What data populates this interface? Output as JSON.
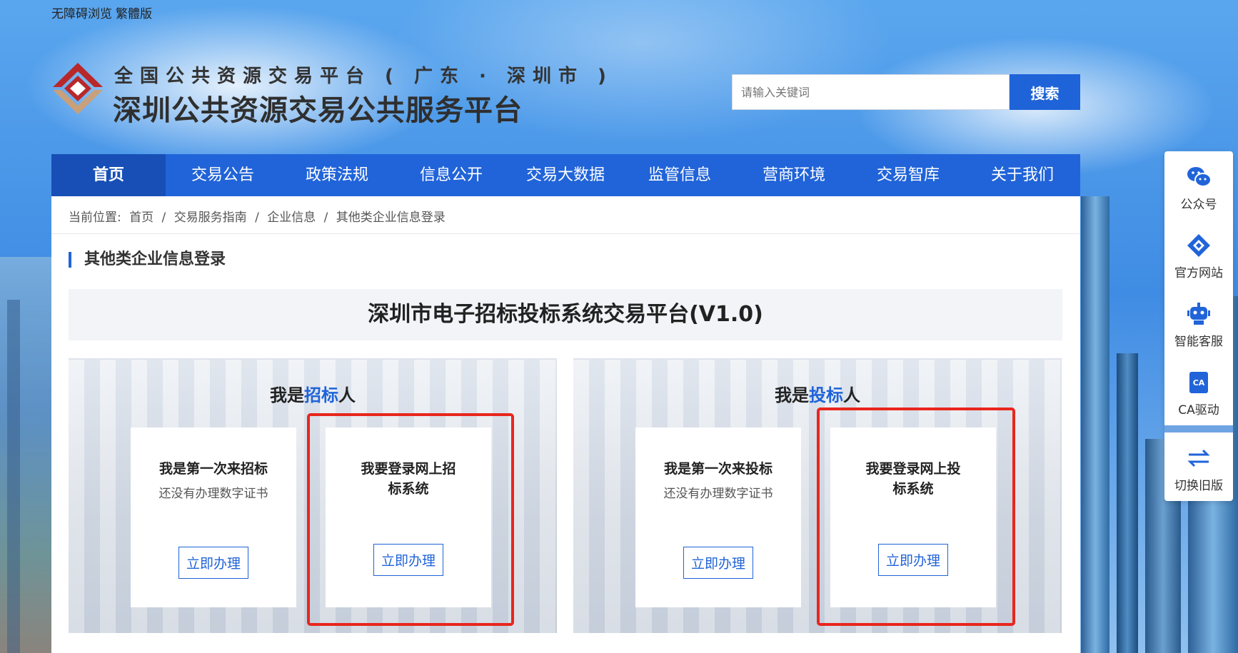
{
  "topbar": {
    "accessible": "无障碍浏览",
    "traditional": "繁體版"
  },
  "header": {
    "logo_line1": "全国公共资源交易平台 ( 广东 · 深圳市 )",
    "logo_line2": "深圳公共资源交易公共服务平台"
  },
  "search": {
    "placeholder": "请输入关键词",
    "button": "搜索"
  },
  "nav": [
    "首页",
    "交易公告",
    "政策法规",
    "信息公开",
    "交易大数据",
    "监管信息",
    "营商环境",
    "交易智库",
    "关于我们"
  ],
  "breadcrumb": {
    "prefix": "当前位置:",
    "items": [
      "首页",
      "交易服务指南",
      "企业信息",
      "其他类企业信息登录"
    ],
    "separator": "/"
  },
  "section_title": "其他类企业信息登录",
  "platform_title": "深圳市电子招标投标系统交易平台(V1.0)",
  "panels": [
    {
      "title_prefix": "我是",
      "title_highlight": "招标",
      "title_suffix": "人",
      "cards": [
        {
          "title": "我是第一次来招标",
          "subtitle": "还没有办理数字证书",
          "button": "立即办理"
        },
        {
          "title": "我要登录网上招标系统",
          "subtitle": "",
          "button": "立即办理"
        }
      ]
    },
    {
      "title_prefix": "我是",
      "title_highlight": "投标",
      "title_suffix": "人",
      "cards": [
        {
          "title": "我是第一次来投标",
          "subtitle": "还没有办理数字证书",
          "button": "立即办理"
        },
        {
          "title": "我要登录网上投标系统",
          "subtitle": "",
          "button": "立即办理"
        }
      ]
    }
  ],
  "sidebar": [
    {
      "label": "公众号",
      "icon": "wechat-icon"
    },
    {
      "label": "官方网站",
      "icon": "website-icon"
    },
    {
      "label": "智能客服",
      "icon": "robot-icon"
    },
    {
      "label": "CA驱动",
      "icon": "ca-icon"
    },
    {
      "label": "切换旧版",
      "icon": "switch-icon"
    }
  ],
  "colors": {
    "primary": "#2164d9",
    "highlight_box": "#e8261d"
  }
}
